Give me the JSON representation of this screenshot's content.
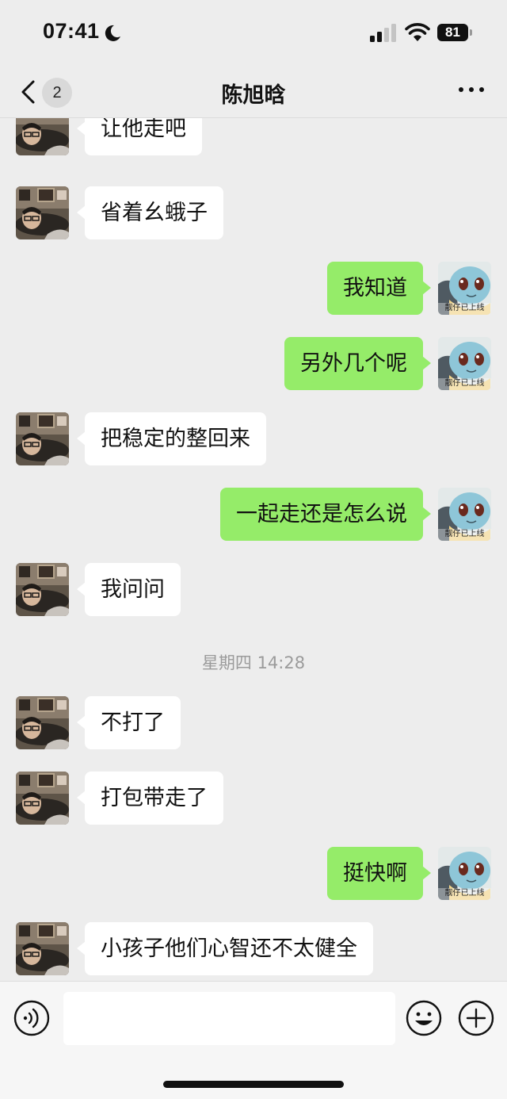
{
  "status_bar": {
    "time": "07:41",
    "battery_level": "81"
  },
  "nav": {
    "title": "陈旭晗",
    "unread_count": "2"
  },
  "avatars": {
    "contact": {
      "description": "photo-avatar"
    },
    "self": {
      "description": "squirtle-avatar",
      "caption": "靓仔已上线"
    }
  },
  "messages": [
    {
      "side": "left",
      "text": "让他走吧"
    },
    {
      "side": "left",
      "text": "省着幺蛾子"
    },
    {
      "side": "right",
      "text": "我知道"
    },
    {
      "side": "right",
      "text": "另外几个呢"
    },
    {
      "side": "left",
      "text": "把稳定的整回来"
    },
    {
      "side": "right",
      "text": "一起走还是怎么说"
    },
    {
      "side": "left",
      "text": "我问问"
    },
    {
      "timestamp": "星期四 14:28"
    },
    {
      "side": "left",
      "text": "不打了"
    },
    {
      "side": "left",
      "text": "打包带走了"
    },
    {
      "side": "right",
      "text": "挺快啊"
    },
    {
      "side": "left",
      "text": "小孩子他们心智还不太健全"
    }
  ],
  "colors": {
    "background": "#ededed",
    "outgoing_bubble": "#95ec69",
    "incoming_bubble": "#ffffff",
    "timestamp": "#9b9b9b"
  }
}
